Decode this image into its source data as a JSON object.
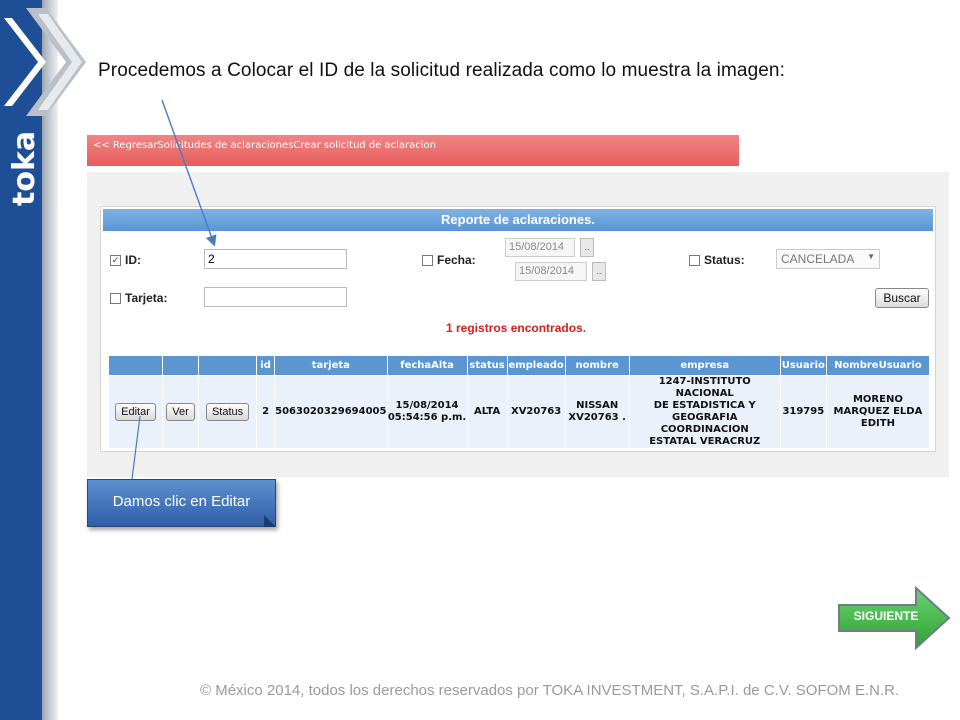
{
  "brand": {
    "logo_text": "TOKA",
    "primary_color": "#1d4e96"
  },
  "slide": {
    "title": "Procedemos a Colocar el ID de la solicitud realizada como lo muestra la imagen:"
  },
  "app": {
    "breadcrumb": "<< RegresarSolicitudes de aclaracionesCrear solicitud de aclaracion",
    "report_title": "Reporte de aclaraciones.",
    "filters": {
      "id_label": "ID:",
      "id_checked": true,
      "id_value": "2",
      "tarjeta_label": "Tarjeta:",
      "tarjeta_value": "",
      "fecha_label": "Fecha:",
      "fecha_from": "15/08/2014",
      "fecha_to": "15/08/2014",
      "status_label": "Status:",
      "status_selected": "CANCELADA",
      "search_button": "Buscar"
    },
    "result_count_text": "1 registros encontrados.",
    "table": {
      "columns": [
        "",
        "",
        "",
        "id",
        "tarjeta",
        "fechaAlta",
        "status",
        "empleado",
        "nombre",
        "empresa",
        "Usuario",
        "NombreUsuario"
      ],
      "row": {
        "edit_button": "Editar",
        "view_button": "Ver",
        "status_button": "Status",
        "id": "2",
        "tarjeta": "5063020329694005",
        "fecha_alta_date": "15/08/2014",
        "fecha_alta_time": "05:54:56 p.m.",
        "status": "ALTA",
        "empleado": "XV20763",
        "nombre_line1": "NISSAN",
        "nombre_line2": "XV20763 .",
        "empresa_line1": "1247-INSTITUTO NACIONAL",
        "empresa_line2": "DE ESTADISTICA Y",
        "empresa_line3": "GEOGRAFIA COORDINACION",
        "empresa_line4": "ESTATAL VERACRUZ",
        "usuario": "319795",
        "nombre_usuario_line1": "MORENO",
        "nombre_usuario_line2": "MARQUEZ ELDA",
        "nombre_usuario_line3": "EDITH"
      }
    }
  },
  "callout": {
    "text": "Damos clic en Editar"
  },
  "next_button": {
    "label": "SIGUIENTE",
    "color": "#3cb843"
  },
  "footer": {
    "text": "© México 2014, todos los derechos reservados por TOKA INVESTMENT, S.A.P.I. de C.V. SOFOM E.N.R."
  }
}
